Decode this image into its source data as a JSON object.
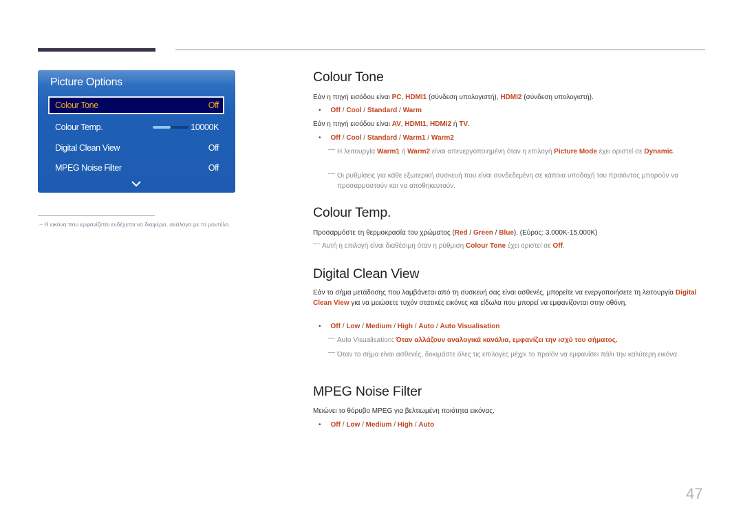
{
  "osd": {
    "title": "Picture Options",
    "items": [
      {
        "label": "Colour Tone",
        "value": "Off",
        "selected": true
      },
      {
        "label": "Colour Temp.",
        "value": "10000K",
        "slider_fraction": 0.5
      },
      {
        "label": "Digital Clean View",
        "value": "Off"
      },
      {
        "label": "MPEG Noise Filter",
        "value": "Off"
      }
    ],
    "scroll_icon": "chevron-down-icon"
  },
  "footnote": "Η εικόνα που εμφανίζεται ενδέχεται να διαφέρει, ανάλογα με το μοντέλο.",
  "sections": {
    "colour_tone": {
      "title": "Colour Tone",
      "p1": [
        "Εάν η πηγή εισόδου είναι ",
        "PC",
        ", ",
        "HDMI1",
        " (σύνδεση υπολογιστή), ",
        "HDMI2",
        " (σύνδεση υπολογιστή)."
      ],
      "opts1": [
        "Off",
        "Cool",
        "Standard",
        "Warm"
      ],
      "p2": [
        "Εάν η πηγή εισόδου είναι ",
        "AV",
        ", ",
        "HDMI1",
        ", ",
        "HDMI2",
        " ή ",
        "TV",
        "."
      ],
      "opts2": [
        "Off",
        "Cool",
        "Standard",
        "Warm1",
        "Warm2"
      ],
      "note1": [
        "Η λειτουργία ",
        "Warm1",
        " ή ",
        "Warm2",
        " είναι απενεργοποιημένη όταν η επιλογή ",
        "Picture Mode",
        " έχει οριστεί σε ",
        "Dynamic",
        "."
      ],
      "note2": "Οι ρυθμίσεις για κάθε εξωτερική συσκευή που είναι συνδεδεμένη σε κάποια υποδοχή του προϊόντος μπορούν να προσαρμοστούν και να αποθηκευτούν."
    },
    "colour_temp": {
      "title": "Colour Temp.",
      "p1": [
        "Προσαρμόστε τη θερμοκρασία του χρώματος (",
        "Red",
        " / ",
        "Green",
        " / ",
        "Blue",
        "). (Εύρος: 3.000K-15.000K)"
      ],
      "note1": [
        "Αυτή η επιλογή είναι διαθέσιμη όταν η ρύθμιση ",
        "Colour Tone",
        " έχει οριστεί σε ",
        "Off",
        "."
      ]
    },
    "digital_clean_view": {
      "title": "Digital Clean View",
      "p1": [
        "Εάν το σήμα μετάδοσης που λαμβάνεται από τη συσκευή σας είναι ασθενές, μπορείτε να ενεργοποιήσετε τη λειτουργία ",
        "Digital Clean View",
        " για να μειώσετε τυχόν στατικές εικόνες και είδωλα που μπορεί να εμφανίζονται στην οθόνη."
      ],
      "opts": [
        "Off",
        "Low",
        "Medium",
        "High",
        "Auto",
        "Auto Visualisation"
      ],
      "note1": [
        "Auto Visualisation",
        ": Όταν αλλάζουν αναλογικά κανάλια, εμφανίζει την ισχύ του σήματος."
      ],
      "note2": "Όταν το σήμα είναι ασθενές, δοκιμάστε όλες τις επιλογές μέχρι το προϊόν να εμφανίσει πάλι την καλύτερη εικόνα."
    },
    "mpeg_noise_filter": {
      "title": "MPEG Noise Filter",
      "p1": "Μειώνει το θόρυβο MPEG για βελτιωμένη ποιότητα εικόνας.",
      "opts": [
        "Off",
        "Low",
        "Medium",
        "High",
        "Auto"
      ]
    }
  },
  "page_number": "47",
  "colors": {
    "accent": "#c2461f",
    "osd_bg": "#1f5fb5",
    "osd_selected": "#00035f",
    "osd_selected_text": "#f5a623"
  }
}
